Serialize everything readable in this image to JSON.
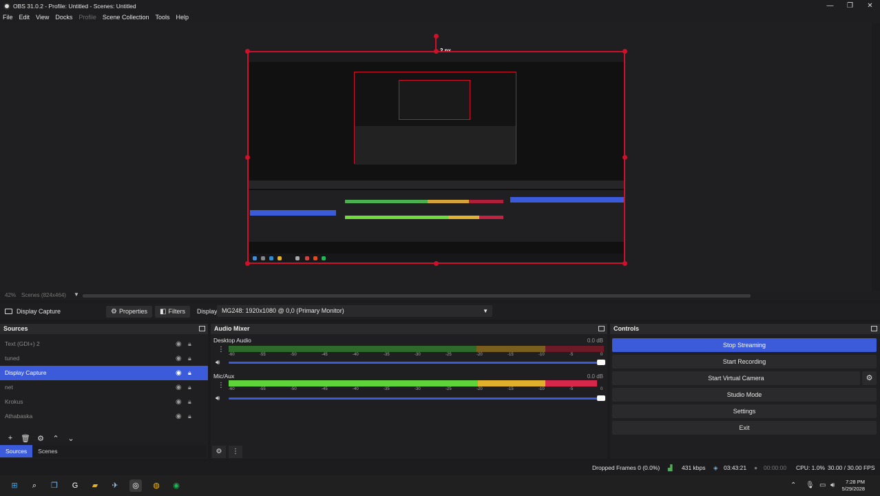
{
  "window": {
    "title": "OBS 31.0.2 - Profile: Untitled - Scenes: Untitled",
    "controls": [
      "—",
      "❐",
      "✕"
    ]
  },
  "menu": [
    "File",
    "Edit",
    "View",
    "Docks",
    "Profile",
    "Scene Collection",
    "Tools",
    "Help"
  ],
  "preview": {
    "size_label": "2 px",
    "accent": "#d0102a"
  },
  "zoombar": {
    "zoom": "42%",
    "scene": "Scenes (824x464)"
  },
  "source_toolbar": {
    "source_name": "Display Capture",
    "properties_label": "Properties",
    "filters_label": "Filters",
    "display_label": "Display",
    "display_value": "MG248: 1920x1080 @ 0,0 (Primary Monitor)"
  },
  "sources": {
    "title": "Sources",
    "items": [
      {
        "label": "Text (GDI+) 2",
        "selected": false
      },
      {
        "label": "tuned",
        "selected": false
      },
      {
        "label": "Display Capture",
        "selected": true
      },
      {
        "label": "net",
        "selected": false
      },
      {
        "label": "Krokus",
        "selected": false
      },
      {
        "label": "Athabaska",
        "selected": false
      }
    ],
    "tabs": [
      "Sources",
      "Scenes"
    ]
  },
  "mixer": {
    "title": "Audio Mixer",
    "channels": [
      {
        "name": "Desktop Audio",
        "db": "0.0 dB",
        "level": 0.7
      },
      {
        "name": "Mic/Aux",
        "db": "0.0 dB",
        "level": 0.98
      }
    ],
    "ticks": [
      "-60",
      "-55",
      "-50",
      "-45",
      "-40",
      "-35",
      "-30",
      "-25",
      "-20",
      "-15",
      "-10",
      "-5",
      "0"
    ]
  },
  "controls": {
    "title": "Controls",
    "buttons": [
      "Stop Streaming",
      "Start Recording",
      "Start Virtual Camera",
      "Studio Mode",
      "Settings",
      "Exit"
    ]
  },
  "status": {
    "dropped": "Dropped Frames 0 (0.0%)",
    "kbps": "431 kbps",
    "stream_time": "03:43:21",
    "rec_time": "00:00:00",
    "cpu": "CPU: 1.0%",
    "fps": "30.00 / 30.00 FPS"
  },
  "taskbar": {
    "time": "7:28 PM",
    "date": "5/29/2028"
  }
}
